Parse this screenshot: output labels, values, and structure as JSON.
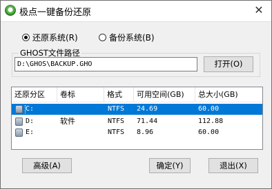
{
  "window": {
    "title": "极点一键备份还原"
  },
  "mode": {
    "restore_label": "还原系统(R)",
    "backup_label": "备份系统(B)",
    "selected": "restore"
  },
  "ghost_path": {
    "label": "GHOST文件路径",
    "value": "D:\\GHOS\\BACKUP.GHO"
  },
  "buttons": {
    "open": "打开(O)",
    "advanced": "高级(A)",
    "ok": "确定(Y)",
    "exit": "退出(X)"
  },
  "table": {
    "headers": [
      "还原分区",
      "卷标",
      "格式",
      "可用空间(GB)",
      "总大小(GB)"
    ],
    "rows": [
      {
        "partition": "C:",
        "label": "",
        "format": "NTFS",
        "free": "24.69",
        "total": "60.00",
        "selected": true
      },
      {
        "partition": "D:",
        "label": "软件",
        "format": "NTFS",
        "free": "71.44",
        "total": "112.88",
        "selected": false
      },
      {
        "partition": "E:",
        "label": "",
        "format": "NTFS",
        "free": "8.96",
        "total": "60.00",
        "selected": false
      }
    ]
  },
  "icons": {
    "app": "app-icon",
    "close": "close-icon",
    "disk": "disk-icon"
  },
  "colors": {
    "selection": "#0078d7",
    "window_bg": "#f0f0f0"
  }
}
